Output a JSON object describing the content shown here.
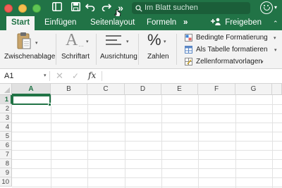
{
  "titlebar": {
    "search_placeholder": "Im Blatt suchen",
    "icons": [
      "sidebar-icon",
      "save-icon",
      "undo-icon",
      "redo-icon",
      "more-icon",
      "search-icon",
      "smiley-feedback-icon"
    ],
    "overflow_label": "»",
    "brand_color": "#217346"
  },
  "tabs": [
    {
      "label": "Start",
      "active": true
    },
    {
      "label": "Einfügen",
      "active": false
    },
    {
      "label": "Seitenlayout",
      "active": false
    },
    {
      "label": "Formeln",
      "active": false
    }
  ],
  "tabs_overflow": "»",
  "share_label": "Freigeben",
  "ribbon": {
    "groups": [
      {
        "label": "Zwischenablage",
        "icon": "clipboard-icon"
      },
      {
        "label": "Schriftart",
        "icon": "font-icon"
      },
      {
        "label": "Ausrichtung",
        "icon": "align-icon"
      },
      {
        "label": "Zahlen",
        "icon": "percent-icon"
      }
    ],
    "styles": [
      {
        "label": "Bedingte Formatierung",
        "icon": "conditional-format-icon"
      },
      {
        "label": "Als Tabelle formatieren",
        "icon": "format-table-icon"
      },
      {
        "label": "Zellenformatvorlagen",
        "icon": "cell-styles-icon"
      }
    ],
    "font_glyph": "A",
    "percent_glyph": "%"
  },
  "formula_bar": {
    "name_box": "A1",
    "cancel_glyph": "✕",
    "confirm_glyph": "✓",
    "fx_label": "fx",
    "formula": ""
  },
  "sheet": {
    "columns": [
      "A",
      "B",
      "C",
      "D",
      "E",
      "F",
      "G"
    ],
    "rows": [
      "1",
      "2",
      "3",
      "4",
      "5",
      "6",
      "7",
      "8",
      "9",
      "10"
    ],
    "selected_cell": "A1"
  }
}
